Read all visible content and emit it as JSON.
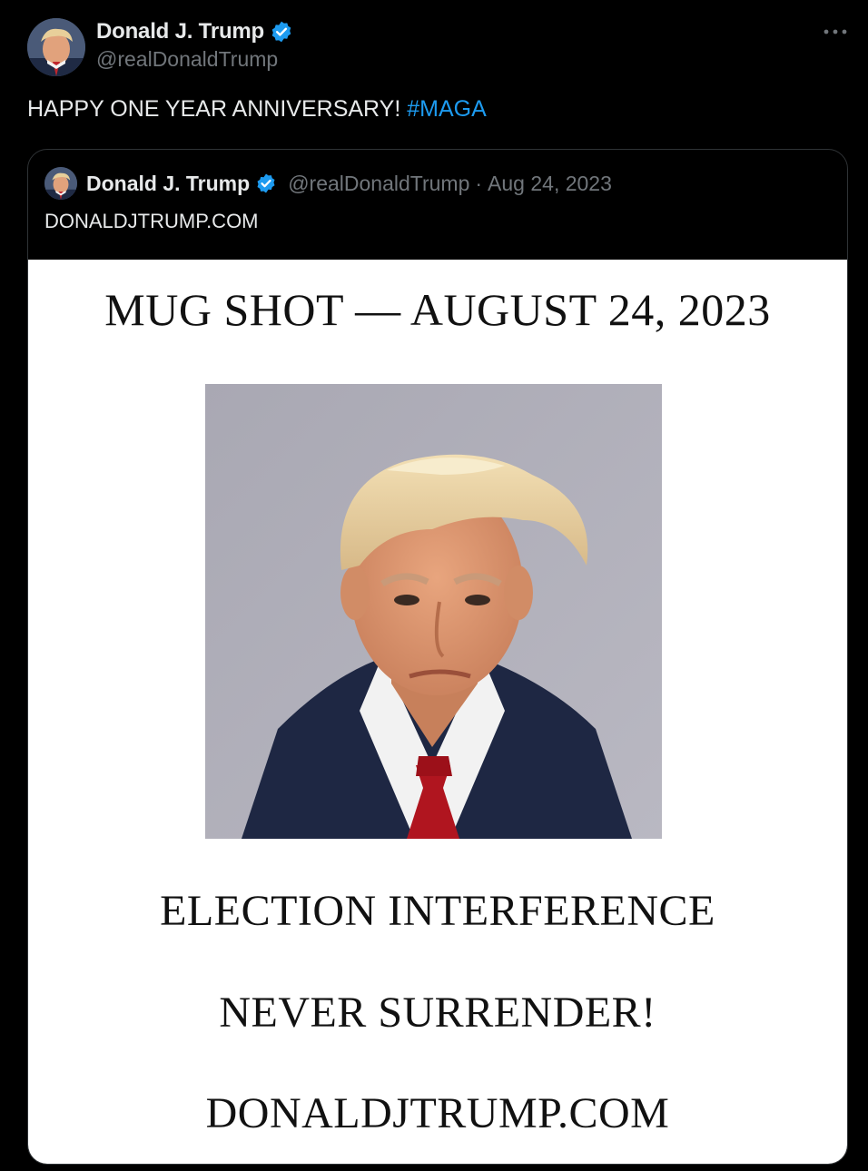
{
  "tweet": {
    "author": {
      "display_name": "Donald J. Trump",
      "handle": "@realDonaldTrump",
      "verified": true,
      "avatar_icon": "profile-photo"
    },
    "text": "HAPPY ONE YEAR ANNIVERSARY! ",
    "hashtag": "#MAGA",
    "more_icon": "ellipsis-icon"
  },
  "quote": {
    "author": {
      "display_name": "Donald J. Trump",
      "handle": "@realDonaldTrump",
      "verified": true
    },
    "separator": "·",
    "date": "Aug 24, 2023",
    "text": "DONALDJTRUMP.COM",
    "image": {
      "title": "MUG SHOT — AUGUST 24, 2023",
      "line1": "ELECTION INTERFERENCE",
      "line2": "NEVER SURRENDER!",
      "line3": "DONALDJTRUMP.COM"
    }
  },
  "colors": {
    "background": "#000000",
    "text": "#e7e9ea",
    "secondary": "#71767b",
    "link": "#1d9bf0",
    "verified": "#1d9bf0",
    "border": "#2f3336"
  }
}
